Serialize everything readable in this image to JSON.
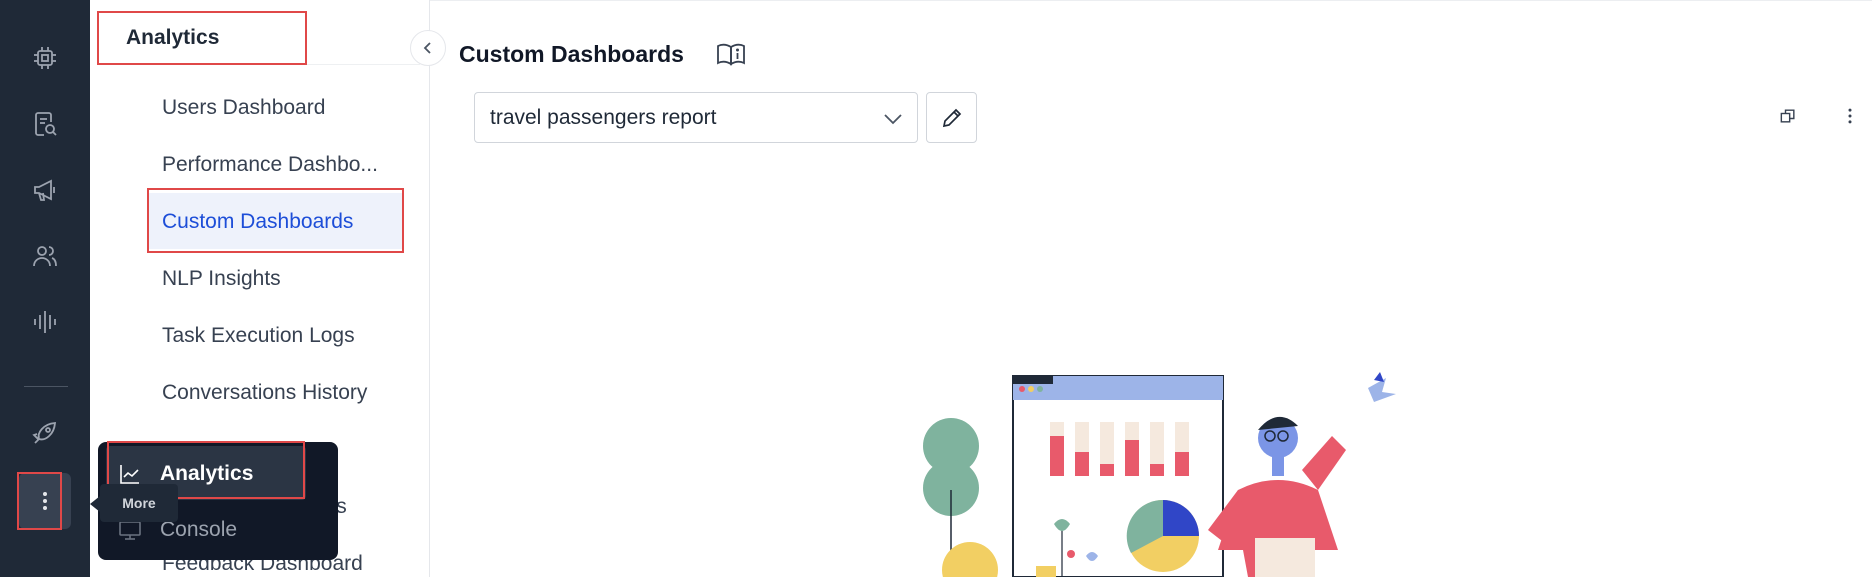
{
  "rail": {
    "icons": [
      "chip-icon",
      "document-search-icon",
      "megaphone-icon",
      "users-icon",
      "waveform-icon",
      "rocket-icon"
    ],
    "more_icon": "vertical-dots-icon",
    "tooltip": "More"
  },
  "nav": {
    "header": "Analytics",
    "items": [
      {
        "label": "Users Dashboard"
      },
      {
        "label": "Performance Dashbo..."
      },
      {
        "label": "Custom Dashboards"
      },
      {
        "label": "NLP Insights"
      },
      {
        "label": "Task Execution Logs"
      },
      {
        "label": "Conversations History"
      },
      {
        "label": "ws"
      },
      {
        "label": "ghts"
      },
      {
        "label": "Feedback Dashboard"
      }
    ],
    "collapse_icon": "chevron-left-icon"
  },
  "popup": {
    "items": [
      {
        "label": "Analytics",
        "icon": "chart-line-icon"
      },
      {
        "label": "Console",
        "icon": "monitor-icon"
      }
    ]
  },
  "main": {
    "title": "Custom Dashboards",
    "title_icon": "book-info-icon",
    "select": {
      "value": "travel passengers report"
    },
    "edit_icon": "pencil-icon",
    "top_right_icons": [
      "restore-window-icon",
      "more-vertical-icon"
    ]
  },
  "colors": {
    "rail_bg": "#1f2937",
    "active_text": "#1d4ed8",
    "highlight_border": "#e04848"
  }
}
